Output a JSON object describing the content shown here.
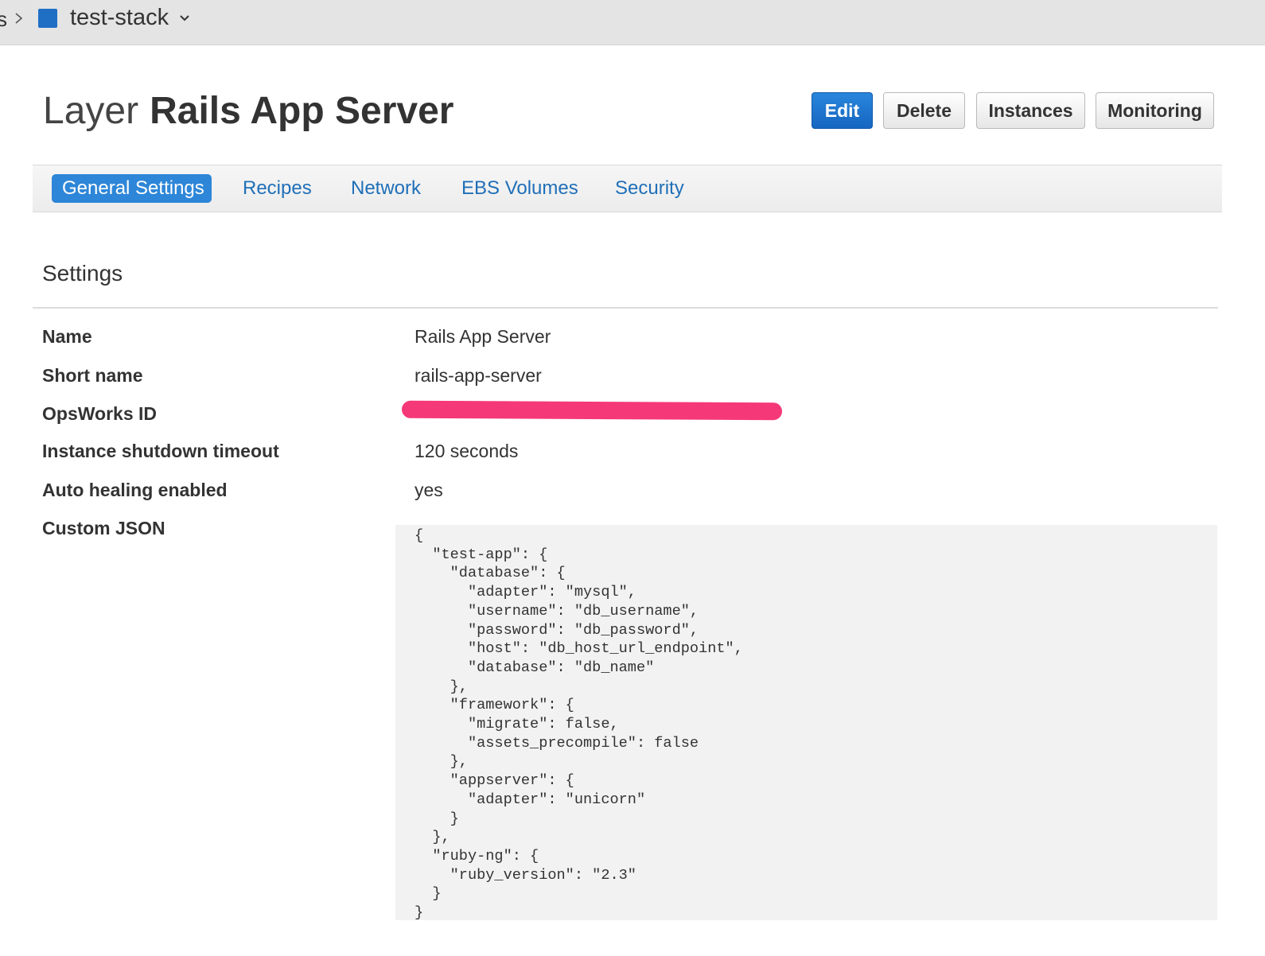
{
  "breadcrumb": {
    "previous_fragment": "s",
    "stack_name": "test-stack"
  },
  "header": {
    "kind": "Layer",
    "name": "Rails App Server"
  },
  "actions": {
    "edit": "Edit",
    "delete": "Delete",
    "instances": "Instances",
    "monitoring": "Monitoring"
  },
  "tabs": [
    {
      "label": "General Settings",
      "active": true
    },
    {
      "label": "Recipes",
      "active": false
    },
    {
      "label": "Network",
      "active": false
    },
    {
      "label": "EBS Volumes",
      "active": false
    },
    {
      "label": "Security",
      "active": false
    }
  ],
  "settings": {
    "title": "Settings",
    "rows": [
      {
        "label": "Name",
        "value": "Rails App Server"
      },
      {
        "label": "Short name",
        "value": "rails-app-server"
      },
      {
        "label": "OpsWorks ID",
        "value": ""
      },
      {
        "label": "Instance shutdown timeout",
        "value": "120 seconds"
      },
      {
        "label": "Auto healing enabled",
        "value": "yes"
      },
      {
        "label": "Custom JSON",
        "value": ""
      }
    ],
    "custom_json": "{\n  \"test-app\": {\n    \"database\": {\n      \"adapter\": \"mysql\",\n      \"username\": \"db_username\",\n      \"password\": \"db_password\",\n      \"host\": \"db_host_url_endpoint\",\n      \"database\": \"db_name\"\n    },\n    \"framework\": {\n      \"migrate\": false,\n      \"assets_precompile\": false\n    },\n    \"appserver\": {\n      \"adapter\": \"unicorn\"\n    }\n  },\n  \"ruby-ng\": {\n    \"ruby_version\": \"2.3\"\n  }\n}"
  },
  "colors": {
    "primary_button": "#1f72c8",
    "link": "#1f6fb8",
    "stack_icon": "#1f6fc5",
    "redaction": "#f53878"
  },
  "icons": {
    "breadcrumb_separator": "chevron-right-icon",
    "stack": "stack-square-icon",
    "stack_dropdown": "chevron-down-icon"
  }
}
